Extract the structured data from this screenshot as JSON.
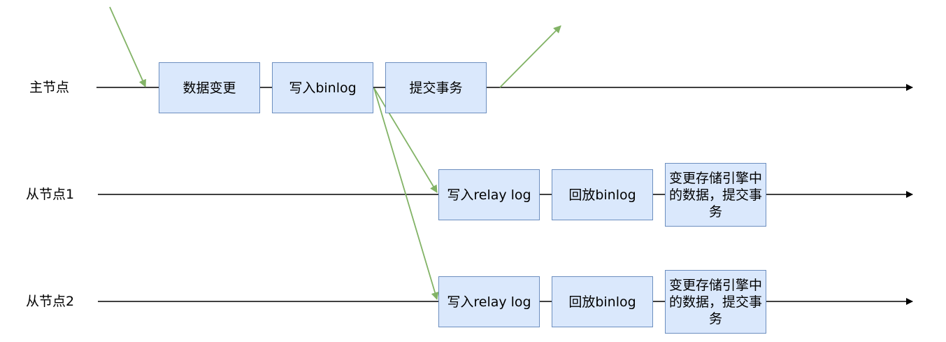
{
  "colors": {
    "box_fill": "#dae8fc",
    "box_border": "#6c8ebf",
    "timeline": "#000000",
    "flow_arrow": "#82b366"
  },
  "lanes": {
    "master": {
      "label": "主节点",
      "steps": [
        "数据变更",
        "写入binlog",
        "提交事务"
      ]
    },
    "slave1": {
      "label": "从节点1",
      "steps": [
        "写入relay log",
        "回放binlog",
        "变更存储引擎中的数据，提交事务"
      ]
    },
    "slave2": {
      "label": "从节点2",
      "steps": [
        "写入relay log",
        "回放binlog",
        "变更存储引擎中的数据，提交事务"
      ]
    }
  }
}
